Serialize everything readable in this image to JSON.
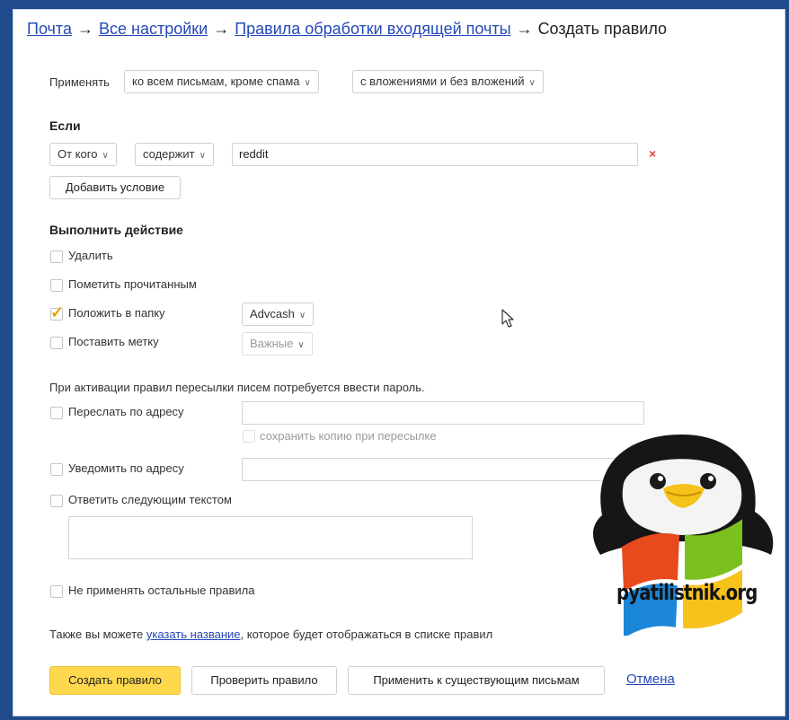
{
  "breadcrumb": {
    "items": [
      "Почта",
      "Все настройки",
      "Правила обработки входящей почты"
    ],
    "current": "Создать правило",
    "separator": "→"
  },
  "apply": {
    "label": "Применять",
    "scope_value": "ко всем письмам, кроме спама",
    "attach_value": "с вложениями и без вложений"
  },
  "condition": {
    "heading": "Если",
    "field": "От кого",
    "op": "содержит",
    "value": "reddit",
    "remove": "×",
    "add_button": "Добавить условие"
  },
  "actions": {
    "heading": "Выполнить действие",
    "delete": {
      "label": "Удалить",
      "checked": false
    },
    "mark_read": {
      "label": "Пометить прочитанным",
      "checked": false
    },
    "move_to_folder": {
      "label": "Положить в папку",
      "checked": true,
      "folder": "Advcash"
    },
    "set_label": {
      "label": "Поставить метку",
      "checked": false,
      "tag": "Важные"
    }
  },
  "forward": {
    "note": "При активации правил пересылки писем потребуется ввести пароль.",
    "forward_label": "Переслать по адресу",
    "forward_value": "",
    "keep_copy_label": "сохранить копию при пересылке",
    "notify_label": "Уведомить по адресу",
    "notify_value": "",
    "reply_label": "Ответить следующим текстом",
    "reply_text": ""
  },
  "stop_rules": {
    "label": "Не применять остальные правила",
    "checked": false
  },
  "name_hint": {
    "before": "Также вы можете ",
    "link": "указать название",
    "after": ", которое будет отображаться в списке правил"
  },
  "buttons": {
    "create": "Создать правило",
    "check": "Проверить правило",
    "apply_existing": "Применить к существующим письмам",
    "cancel": "Отмена"
  },
  "watermark": "pyatilistnik.org",
  "colors": {
    "link": "#2548b8",
    "primary_button": "#ffd84d",
    "check": "#e0a000",
    "remove": "#e0413b",
    "page_bg": "#1f4a8c"
  }
}
